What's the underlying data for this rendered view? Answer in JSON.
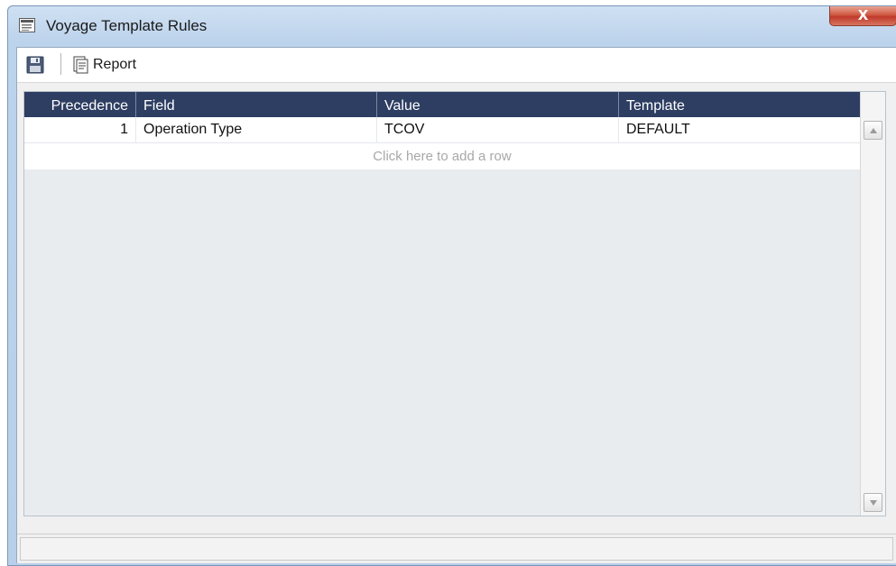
{
  "window": {
    "title": "Voyage Template Rules",
    "close_label": "X"
  },
  "toolbar": {
    "report_label": "Report"
  },
  "grid": {
    "columns": [
      "Precedence",
      "Field",
      "Value",
      "Template"
    ],
    "rows": [
      {
        "precedence": "1",
        "field": "Operation Type",
        "value": "TCOV",
        "template": "DEFAULT"
      }
    ],
    "add_row_text": "Click here to add a row"
  },
  "colors": {
    "header_bg": "#2e3e62",
    "close_button": "#c0392b",
    "title_bar": "#bcd3ec"
  },
  "icons": [
    "window-icon",
    "save-icon",
    "report-icon",
    "scroll-up-icon",
    "scroll-down-icon"
  ]
}
